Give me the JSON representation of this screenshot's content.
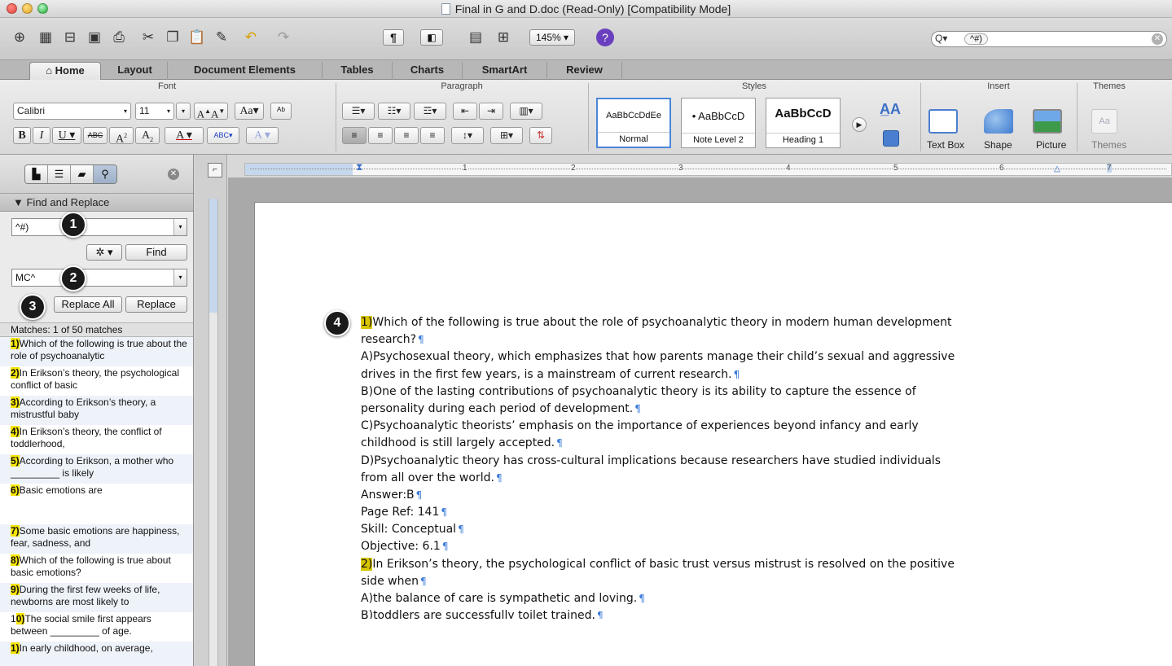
{
  "window": {
    "title": "Final in G and D.doc (Read-Only) [Compatibility Mode]"
  },
  "toolbar": {
    "zoom": "145%",
    "search_value": "^#)"
  },
  "tabs": [
    "Home",
    "Layout",
    "Document Elements",
    "Tables",
    "Charts",
    "SmartArt",
    "Review"
  ],
  "ribbon": {
    "groups": {
      "font": "Font",
      "paragraph": "Paragraph",
      "styles": "Styles",
      "insert": "Insert",
      "themes": "Themes"
    },
    "font_name": "Calibri",
    "font_size": "11",
    "styles": [
      {
        "sample": "AaBbCcDdEe",
        "name": "Normal"
      },
      {
        "sample": "• AaBbCcD",
        "name": "Note Level 2"
      },
      {
        "sample": "AaBbCcD",
        "name": "Heading 1"
      }
    ],
    "insert": [
      "Text Box",
      "Shape",
      "Picture"
    ],
    "themes_label": "Themes"
  },
  "sidebar": {
    "panel_title": "Find and Replace",
    "find_value": "^#)",
    "find_button": "Find",
    "replace_value": "MC^",
    "replace_all_button": "Replace All",
    "replace_button": "Replace",
    "matches_label": "Matches: 1 of 50 matches",
    "matches": [
      {
        "num": "1)",
        "text": "Which of the following is true about the role of psychoanalytic"
      },
      {
        "num": "2)",
        "text": "In Erikson’s theory, the psychological conflict of basic"
      },
      {
        "num": "3)",
        "text": "According to Erikson’s theory, a mistrustful baby"
      },
      {
        "num": "4)",
        "text": "In Erikson’s theory, the conflict of toddlerhood,"
      },
      {
        "num": "5)",
        "text": "According to Erikson, a mother who _________ is likely"
      },
      {
        "num": "6)",
        "text": "Basic emotions are"
      },
      {
        "num": "7)",
        "text": "Some basic emotions are happiness, fear, sadness, and"
      },
      {
        "num": "8)",
        "text": "Which of the following is true about basic emotions?"
      },
      {
        "num": "9)",
        "text": "During the first few weeks of life, newborns are most likely to"
      },
      {
        "pre": "1",
        "num": "0)",
        "text": "The social smile first appears between _________ of age."
      },
      {
        "num": "1)",
        "text": "In early childhood, on average,"
      }
    ]
  },
  "callouts": [
    "1",
    "2",
    "3",
    "4"
  ],
  "ruler_numbers": [
    "1",
    "2",
    "3",
    "4",
    "5",
    "6",
    "7"
  ],
  "document": {
    "lines": [
      {
        "hl": "1)",
        "text": "Which of the following is true about the role of psychoanalytic theory in modern human development",
        "pil": false
      },
      {
        "text": "research?",
        "pil": true
      },
      {
        "text": "A)Psychosexual theory, which emphasizes that how parents manage their child’s sexual and aggressive",
        "pil": false
      },
      {
        "text": "drives in the first few years, is a mainstream of current research.",
        "pil": true
      },
      {
        "text": "B)One of the lasting contributions of psychoanalytic theory is its ability to capture the essence of",
        "pil": false
      },
      {
        "text": "personality during each period of development.",
        "pil": true
      },
      {
        "text": "C)Psychoanalytic theorists’ emphasis on the importance of experiences beyond infancy and early",
        "pil": false
      },
      {
        "text": "childhood is still largely accepted.",
        "pil": true
      },
      {
        "text": "D)Psychoanalytic theory has cross-cultural implications because researchers have studied individuals",
        "pil": false
      },
      {
        "text": "from all over the world.",
        "pil": true
      },
      {
        "text": "Answer:B",
        "pil": true
      },
      {
        "text": "Page Ref: 141",
        "pil": true
      },
      {
        "text": "Skill: Conceptual",
        "pil": true
      },
      {
        "text": "Objective: 6.1",
        "pil": true
      },
      {
        "hl": "2)",
        "text": "In Erikson’s theory, the psychological conflict of basic trust versus mistrust is resolved on the positive",
        "pil": false
      },
      {
        "text": "side when",
        "pil": true
      },
      {
        "text": "A)the balance of care is sympathetic and loving.",
        "pil": true
      },
      {
        "text": "B)toddlers are successfully toilet trained.",
        "pil": true
      }
    ]
  },
  "colors": {
    "match_highlight": "#f5e400",
    "doc_highlight": "#d9c400",
    "pilcrow": "#3b7bd8"
  }
}
